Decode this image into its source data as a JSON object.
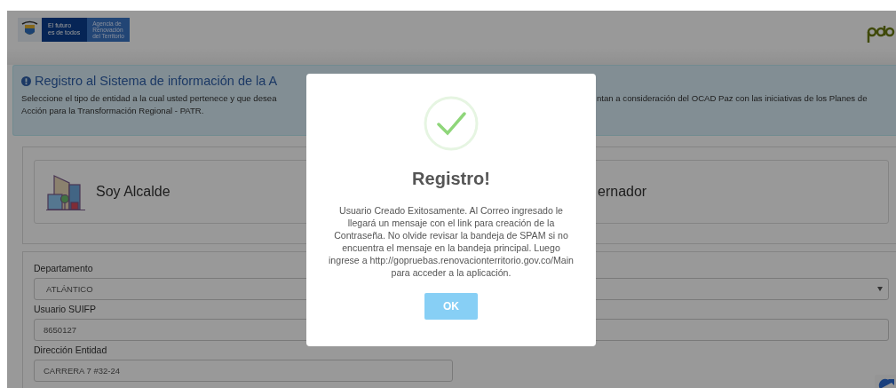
{
  "header": {
    "slogan": [
      "El futuro",
      "es de todos"
    ],
    "agency": [
      "Agencia de",
      "Renovación",
      "del Territorio"
    ]
  },
  "alert": {
    "title": "Registro al Sistema de información de la A",
    "line_1_left": "Seleccione el tipo de entidad a la cual usted pertenece y que desea",
    "line_1_right": "ntan a consideración del OCAD Paz con las iniciativas de los Planes de",
    "line_2": "Acción para la Transformación Regional - PATR."
  },
  "entity_cards": [
    {
      "label": "Soy Alcalde",
      "kind": "building"
    },
    {
      "label": "ernador",
      "kind": "plain"
    }
  ],
  "form": {
    "fields": [
      {
        "label": "Departamento",
        "value": "ATLÁNTICO",
        "kind": "select"
      },
      {
        "label": "Usuario SUIFP",
        "value": "8650127",
        "kind": "input"
      },
      {
        "label": "Dirección Entidad",
        "value": "CARRERA 7 #32-24",
        "kind": "short"
      }
    ]
  },
  "dialog": {
    "title": "Registro!",
    "message": "Usuario Creado Exitosamente. Al Correo ingresado le llegará un mensaje con el link para creación de la Contraseña. No olvide revisar la bandeja de SPAM si no encuentra el mensaje en la bandeja principal. Luego ingrese a http://gopruebas.renovacionterritorio.gov.co/Main para acceder a la aplicación.",
    "button": "OK"
  }
}
